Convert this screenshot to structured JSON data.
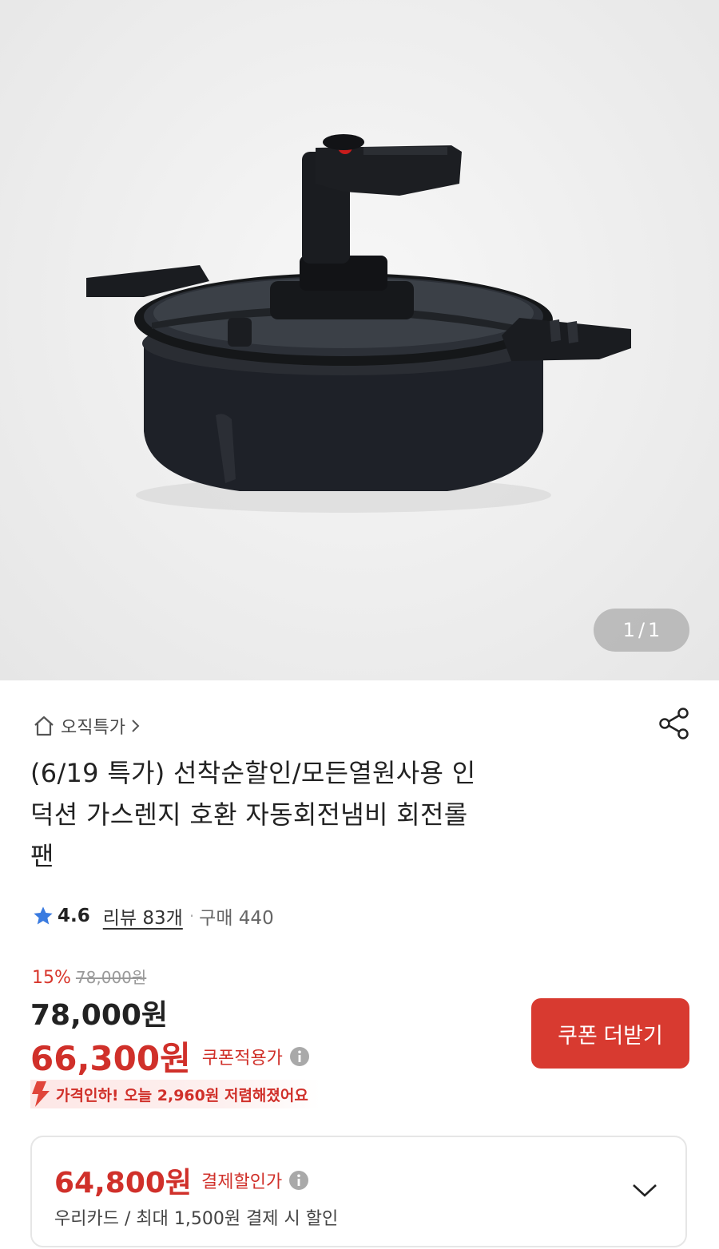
{
  "gallery": {
    "current": "1",
    "separator": "/",
    "total": "1"
  },
  "breadcrumb": {
    "label": "오직특가"
  },
  "product": {
    "title_lines": [
      "(6/19 특가) 선착순할인/모든열원사용 인",
      "덕션 가스렌지 호환 자동회전냄비 회전롤",
      "팬"
    ]
  },
  "rating": {
    "score": "4.6",
    "reviews_label": "리뷰 83개",
    "separator": "·",
    "purchases_label": "구매 440"
  },
  "pricing": {
    "discount_rate": "15%",
    "original_price": "78,000원",
    "sale_price": "78,000원",
    "coupon_price": "66,300원",
    "coupon_label": "쿠폰적용가",
    "coupon_button": "쿠폰 더받기",
    "price_drop_text": "가격인하! 오늘 2,960원 저렴해졌어요"
  },
  "payment_card": {
    "price": "64,800원",
    "label": "결제할인가",
    "detail": "우리카드 / 최대 1,500원 결제 시 할인"
  },
  "colors": {
    "accent": "#d0302a",
    "button": "#d83a30",
    "star": "#3a7be0"
  }
}
